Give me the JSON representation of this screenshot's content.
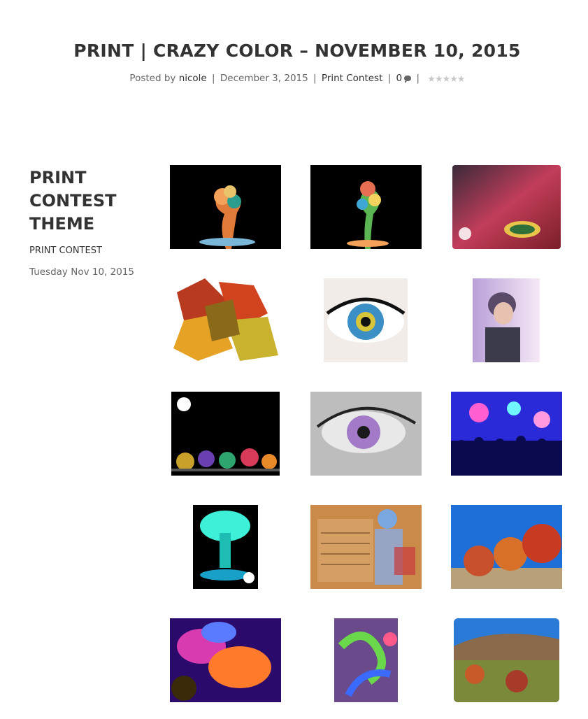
{
  "post": {
    "title": "PRINT | CRAZY COLOR – NOVEMBER 10, 2015",
    "posted_by_label": "Posted by",
    "author": "nicole",
    "date": "December 3, 2015",
    "category": "Print Contest",
    "comment_count": "0",
    "separator": "|",
    "rating_stars": 5
  },
  "sidebar": {
    "title": "PRINT CONTEST THEME",
    "category": "PRINT CONTEST",
    "date": "Tuesday Nov 10, 2015"
  },
  "gallery": {
    "images": [
      {
        "name": "paint-splash-orange",
        "subject": "colorful paint splash on black"
      },
      {
        "name": "paint-splash-green",
        "subject": "colorful paint splash on black"
      },
      {
        "name": "water-droplet",
        "subject": "water droplet on colored surface"
      },
      {
        "name": "autumn-leaves",
        "subject": "autumn maple leaves"
      },
      {
        "name": "blue-eye",
        "subject": "close-up of blue eye"
      },
      {
        "name": "woman-portrait",
        "subject": "woman in knit hat"
      },
      {
        "name": "paint-splashes-row",
        "subject": "row of colorful paint splashes"
      },
      {
        "name": "bw-eye",
        "subject": "black and white eye with purple iris"
      },
      {
        "name": "concert-crowd",
        "subject": "concert crowd with stage lights"
      },
      {
        "name": "cyan-splash",
        "subject": "cyan paint splash"
      },
      {
        "name": "letter-collage",
        "subject": "vintage letter with soldier and flag"
      },
      {
        "name": "autumn-trees",
        "subject": "autumn trees and blue sky"
      },
      {
        "name": "abstract-flower",
        "subject": "abstract colorful flower"
      },
      {
        "name": "sour-candy",
        "subject": "sour gummy candy"
      },
      {
        "name": "autumn-hillside",
        "subject": "autumn hillside"
      }
    ]
  }
}
